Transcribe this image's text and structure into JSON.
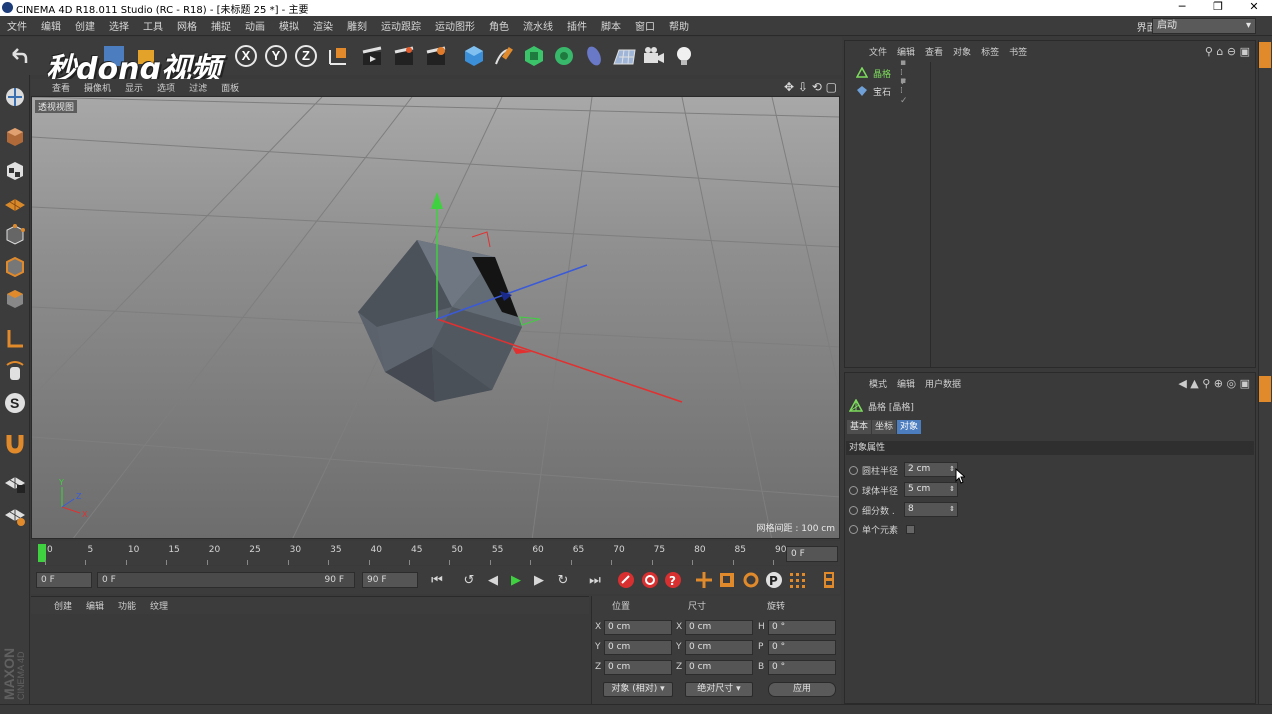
{
  "window": {
    "title": "CINEMA 4D R18.011 Studio (RC - R18) - [未标题 25 *] - 主要",
    "min": "─",
    "max": "❐",
    "close": "✕"
  },
  "menubar": {
    "items": [
      "文件",
      "编辑",
      "创建",
      "选择",
      "工具",
      "网格",
      "捕捉",
      "动画",
      "模拟",
      "渲染",
      "雕刻",
      "运动跟踪",
      "运动图形",
      "角色",
      "流水线",
      "插件",
      "脚本",
      "窗口",
      "帮助"
    ],
    "layout_label": "界面:",
    "layout_value": "启动"
  },
  "watermark": {
    "text": "秒dong视频"
  },
  "toolbar": {
    "axis_x": "X",
    "axis_y": "Y",
    "axis_z": "Z"
  },
  "viewport": {
    "menu": [
      "查看",
      "摄像机",
      "显示",
      "选项",
      "过滤",
      "面板"
    ],
    "label": "透视视图",
    "grid_spacing": "网格间距 : 100 cm"
  },
  "timeline": {
    "ticks": [
      "0",
      "5",
      "10",
      "15",
      "20",
      "25",
      "30",
      "35",
      "40",
      "45",
      "50",
      "55",
      "60",
      "65",
      "70",
      "75",
      "80",
      "85",
      "90"
    ],
    "current_frame": "0 F",
    "start_field": "0 F",
    "range_start": "0 F",
    "range_end": "90 F",
    "end_field": "90 F"
  },
  "material_panel": {
    "menu": [
      "创建",
      "编辑",
      "功能",
      "纹理"
    ]
  },
  "coordinates": {
    "headers": [
      "位置",
      "尺寸",
      "旋转"
    ],
    "rows": [
      {
        "pos_axis": "X",
        "pos": "0 cm",
        "size_axis": "X",
        "size": "0 cm",
        "rot_axis": "H",
        "rot": "0 °"
      },
      {
        "pos_axis": "Y",
        "pos": "0 cm",
        "size_axis": "Y",
        "size": "0 cm",
        "rot_axis": "P",
        "rot": "0 °"
      },
      {
        "pos_axis": "Z",
        "pos": "0 cm",
        "size_axis": "Z",
        "size": "0 cm",
        "rot_axis": "B",
        "rot": "0 °"
      }
    ],
    "mode_select": "对象 (相对)",
    "size_select": "绝对尺寸",
    "apply_button": "应用"
  },
  "object_manager": {
    "menu": [
      "文件",
      "编辑",
      "查看",
      "对象",
      "标签",
      "书签"
    ],
    "objects": [
      {
        "name": "晶格",
        "color": "#7ddc5c"
      },
      {
        "name": "宝石",
        "color": "#d8d8d8"
      }
    ]
  },
  "attribute_manager": {
    "menu": [
      "模式",
      "编辑",
      "用户数据"
    ],
    "object_title": "晶格 [晶格]",
    "tabs": [
      "基本",
      "坐标",
      "对象"
    ],
    "active_tab": "对象",
    "section": "对象属性",
    "fields": [
      {
        "label": "圆柱半径",
        "value": "2 cm"
      },
      {
        "label": "球体半径",
        "value": "5 cm"
      },
      {
        "label": "细分数 .",
        "value": "8"
      }
    ],
    "single_element_label": "单个元素"
  },
  "branding": {
    "maxon": "MAXON",
    "c4d": "CINEMA 4D"
  },
  "colors": {
    "accent": "#4b7dbf",
    "active_tab": "#4b7dbf",
    "x_axis": "#e23030",
    "y_axis": "#3fd13f",
    "z_axis": "#3a5ad8"
  }
}
